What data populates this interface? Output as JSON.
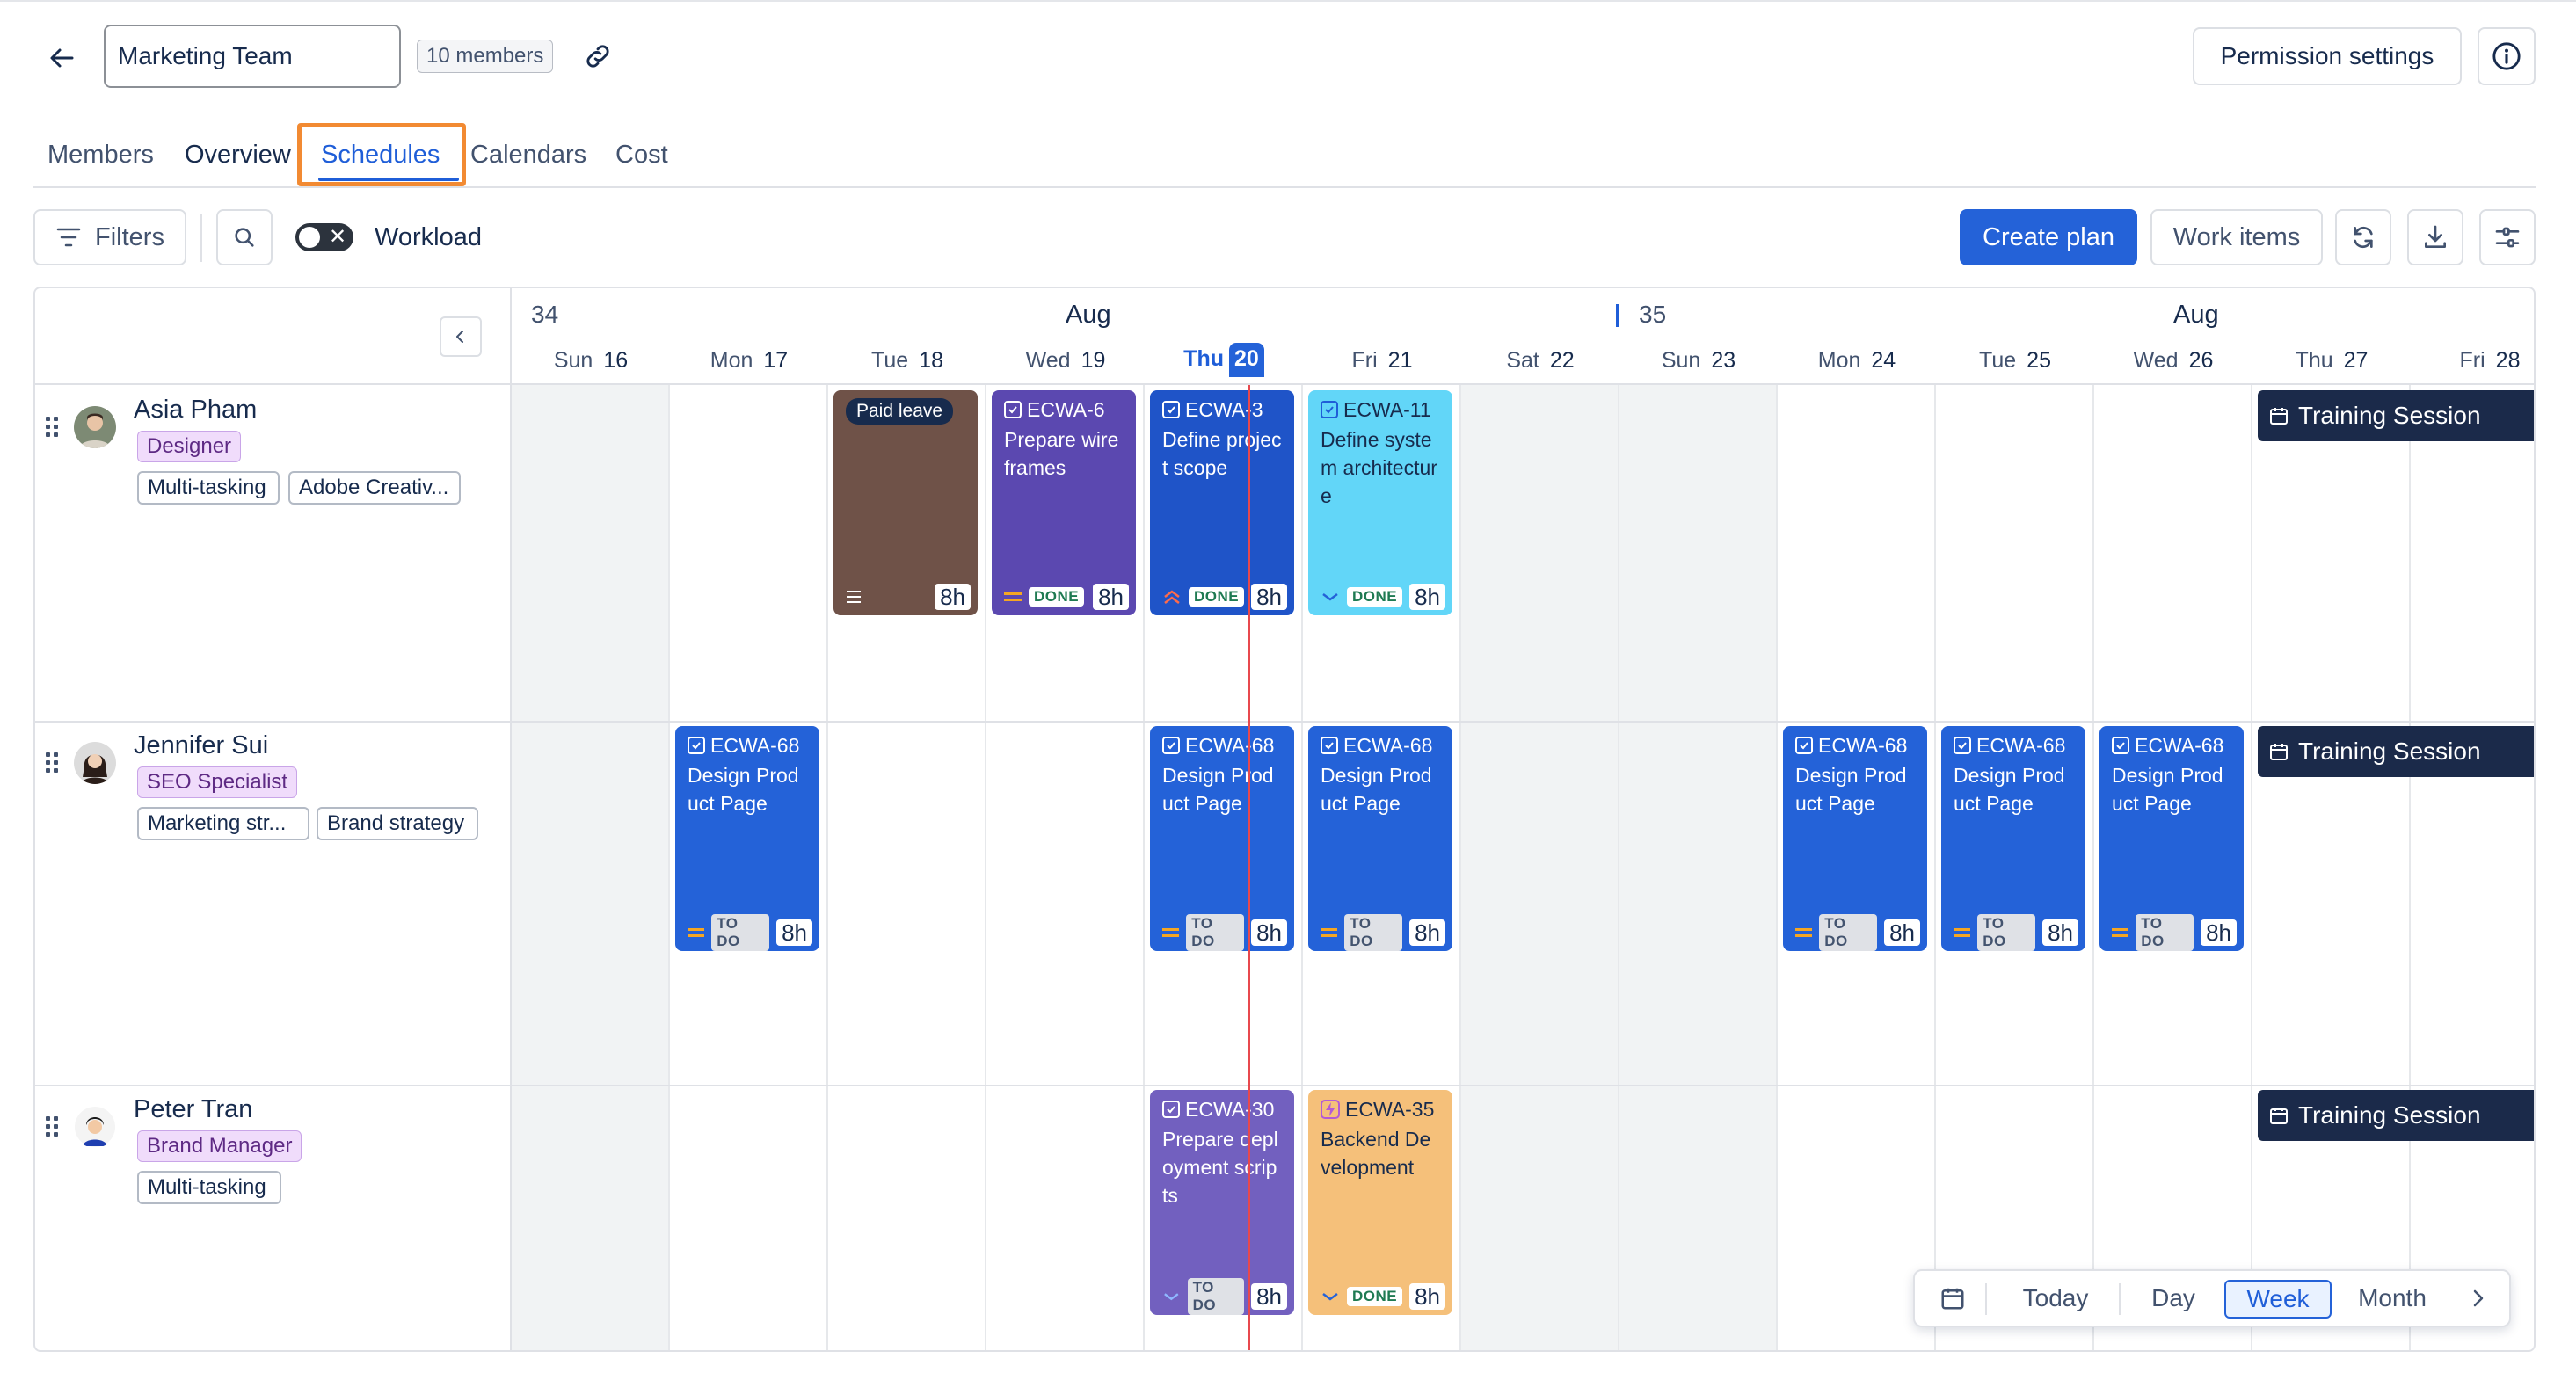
{
  "header": {
    "team_name": "Marketing Team",
    "members_badge": "10 members",
    "permission_settings": "Permission settings"
  },
  "tabs": [
    {
      "label": "Members"
    },
    {
      "label": "Overview"
    },
    {
      "label": "Schedules",
      "selected": true
    },
    {
      "label": "Calendars"
    },
    {
      "label": "Cost"
    }
  ],
  "toolbar": {
    "filters": "Filters",
    "workload": "Workload",
    "workload_on": false,
    "create_plan": "Create plan",
    "work_items": "Work items",
    "toggle_x": "✕"
  },
  "calendar": {
    "weeks": [
      {
        "number": "34",
        "month": "Aug"
      },
      {
        "number": "35",
        "month": "Aug"
      }
    ],
    "days": [
      {
        "name": "Sun",
        "num": "16"
      },
      {
        "name": "Mon",
        "num": "17"
      },
      {
        "name": "Tue",
        "num": "18"
      },
      {
        "name": "Wed",
        "num": "19"
      },
      {
        "name": "Thu",
        "num": "20",
        "today": true
      },
      {
        "name": "Fri",
        "num": "21"
      },
      {
        "name": "Sat",
        "num": "22"
      },
      {
        "name": "Sun",
        "num": "23"
      },
      {
        "name": "Mon",
        "num": "24"
      },
      {
        "name": "Tue",
        "num": "25"
      },
      {
        "name": "Wed",
        "num": "26"
      },
      {
        "name": "Thu",
        "num": "27"
      },
      {
        "name": "Fri",
        "num": "28"
      }
    ]
  },
  "people": [
    {
      "name": "Asia Pham",
      "role": "Designer",
      "skills": [
        "Multi-tasking",
        "Adobe Creativ..."
      ],
      "cards": [
        {
          "label": "Paid leave",
          "hours": "8h"
        },
        {
          "key": "ECWA-6",
          "title": "Prepare wireframes",
          "status": "DONE",
          "hours": "8h"
        },
        {
          "key": "ECWA-3",
          "title": "Define project scope",
          "status": "DONE",
          "hours": "8h"
        },
        {
          "key": "ECWA-11",
          "title": "Define system architecture",
          "status": "DONE",
          "hours": "8h"
        }
      ],
      "event": "Training Session"
    },
    {
      "name": "Jennifer Sui",
      "role": "SEO Specialist",
      "skills": [
        "Marketing str...",
        "Brand strategy"
      ],
      "cards": [
        {
          "key": "ECWA-68",
          "title": "Design Product Page",
          "status": "TO DO",
          "hours": "8h"
        },
        {
          "key": "ECWA-68",
          "title": "Design Product Page",
          "status": "TO DO",
          "hours": "8h"
        },
        {
          "key": "ECWA-68",
          "title": "Design Product Page",
          "status": "TO DO",
          "hours": "8h"
        },
        {
          "key": "ECWA-68",
          "title": "Design Product Page",
          "status": "TO DO",
          "hours": "8h"
        },
        {
          "key": "ECWA-68",
          "title": "Design Product Page",
          "status": "TO DO",
          "hours": "8h"
        },
        {
          "key": "ECWA-68",
          "title": "Design Product Page",
          "status": "TO DO",
          "hours": "8h"
        }
      ],
      "event": "Training Session"
    },
    {
      "name": "Peter Tran",
      "role": "Brand Manager",
      "skills": [
        "Multi-tasking"
      ],
      "cards": [
        {
          "key": "ECWA-30",
          "title": "Prepare deployment scripts",
          "status": "TO DO",
          "hours": "8h"
        },
        {
          "key": "ECWA-35",
          "title": "Backend Development",
          "status": "DONE",
          "hours": "8h"
        }
      ],
      "event": "Training Session"
    }
  ],
  "date_nav": {
    "today": "Today",
    "day": "Day",
    "week": "Week",
    "month": "Month",
    "selected": "Week"
  },
  "colors": {
    "accent": "#2462d8",
    "today_line": "#e8484d",
    "tab_highlight": "#f28a32",
    "event": "#1b2a4a"
  }
}
